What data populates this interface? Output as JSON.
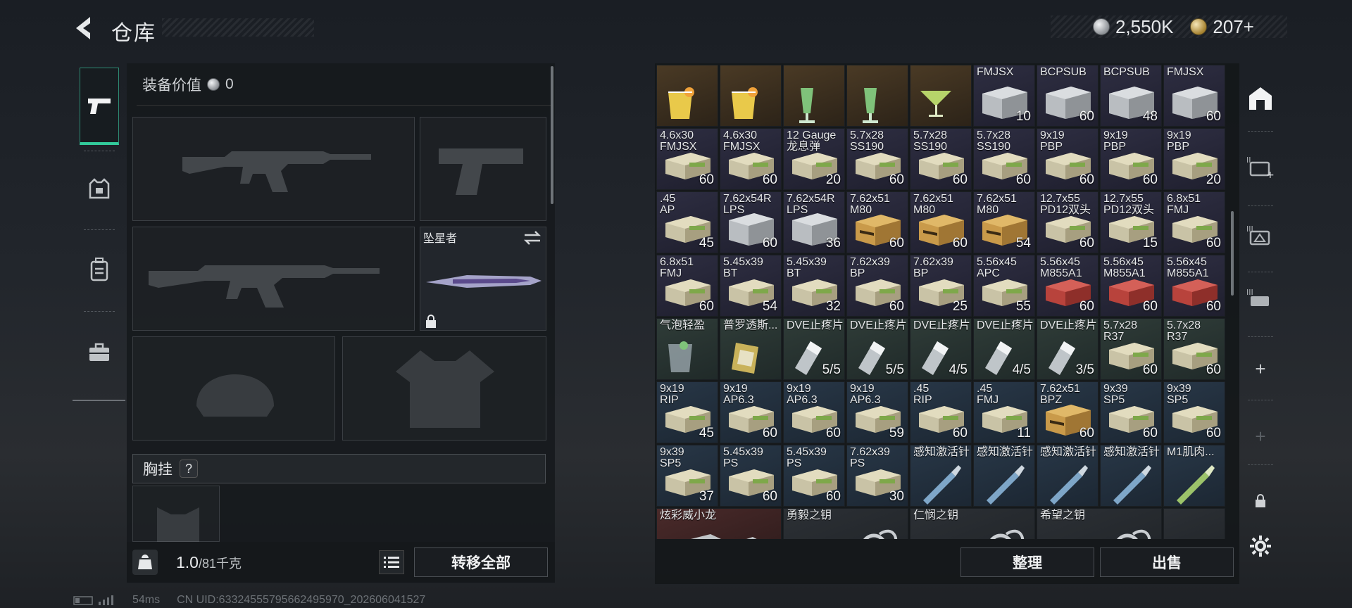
{
  "header": {
    "title": "仓库"
  },
  "currency": {
    "silver": "2,550K",
    "gold": "207+"
  },
  "equipment": {
    "value_label": "装备价值",
    "value": "0",
    "melee_name": "坠星者",
    "chest_label": "胸挂",
    "help": "?"
  },
  "footer": {
    "weight": "1.0",
    "weight_max": "/81千克",
    "move_all": "转移全部"
  },
  "status": {
    "ping": "54ms",
    "uid": "CN UID:6332455579566249597​0_202606041527"
  },
  "actions": {
    "sort": "整理",
    "sell": "出售"
  },
  "grid": {
    "rows": [
      [
        {
          "name": "",
          "count": "",
          "rarity": "gold",
          "art": "drink"
        },
        {
          "name": "",
          "count": "",
          "rarity": "gold",
          "art": "drink"
        },
        {
          "name": "",
          "count": "",
          "rarity": "gold",
          "art": "drink2"
        },
        {
          "name": "",
          "count": "",
          "rarity": "gold",
          "art": "drink2"
        },
        {
          "name": "",
          "count": "",
          "rarity": "gold",
          "art": "drink3"
        },
        {
          "name": "FMJSX",
          "count": "10",
          "rarity": "purple",
          "art": "box"
        },
        {
          "name": "BCPSUB",
          "count": "60",
          "rarity": "purple",
          "art": "box"
        },
        {
          "name": "BCPSUB",
          "count": "48",
          "rarity": "purple",
          "art": "box"
        },
        {
          "name": "FMJSX",
          "count": "60",
          "rarity": "purple",
          "art": "box"
        }
      ],
      [
        {
          "name": "4.6x30\nFMJSX",
          "count": "60",
          "rarity": "purple",
          "art": "ammo"
        },
        {
          "name": "4.6x30\nFMJSX",
          "count": "60",
          "rarity": "purple",
          "art": "ammo"
        },
        {
          "name": "12 Gauge\n龙息弹",
          "count": "20",
          "rarity": "purple",
          "art": "ammo"
        },
        {
          "name": "5.7x28\nSS190",
          "count": "60",
          "rarity": "purple",
          "art": "ammo"
        },
        {
          "name": "5.7x28\nSS190",
          "count": "60",
          "rarity": "purple",
          "art": "ammo"
        },
        {
          "name": "5.7x28\nSS190",
          "count": "60",
          "rarity": "purple",
          "art": "ammo"
        },
        {
          "name": "9x19\nPBP",
          "count": "60",
          "rarity": "purple",
          "art": "ammo"
        },
        {
          "name": "9x19\nPBP",
          "count": "60",
          "rarity": "purple",
          "art": "ammo"
        },
        {
          "name": "9x19\nPBP",
          "count": "20",
          "rarity": "purple",
          "art": "ammo"
        }
      ],
      [
        {
          "name": ".45\nAP",
          "count": "45",
          "rarity": "purple",
          "art": "ammo"
        },
        {
          "name": "7.62x54R\nLPS",
          "count": "60",
          "rarity": "purple",
          "art": "box"
        },
        {
          "name": "7.62x54R\nLPS",
          "count": "36",
          "rarity": "purple",
          "art": "box"
        },
        {
          "name": "7.62x51\nM80",
          "count": "60",
          "rarity": "purple",
          "art": "gold"
        },
        {
          "name": "7.62x51\nM80",
          "count": "60",
          "rarity": "purple",
          "art": "gold"
        },
        {
          "name": "7.62x51\nM80",
          "count": "54",
          "rarity": "purple",
          "art": "gold"
        },
        {
          "name": "12.7x55\nPD12双头",
          "count": "60",
          "rarity": "purple",
          "art": "ammo"
        },
        {
          "name": "12.7x55\nPD12双头",
          "count": "15",
          "rarity": "purple",
          "art": "ammo"
        },
        {
          "name": "6.8x51\nFMJ",
          "count": "60",
          "rarity": "purple",
          "art": "ammo"
        }
      ],
      [
        {
          "name": "6.8x51\nFMJ",
          "count": "60",
          "rarity": "purple",
          "art": "ammo"
        },
        {
          "name": "5.45x39\nBT",
          "count": "54",
          "rarity": "purple",
          "art": "ammo"
        },
        {
          "name": "5.45x39\nBT",
          "count": "32",
          "rarity": "purple",
          "art": "ammo"
        },
        {
          "name": "7.62x39\nBP",
          "count": "60",
          "rarity": "purple",
          "art": "ammo"
        },
        {
          "name": "7.62x39\nBP",
          "count": "25",
          "rarity": "purple",
          "art": "ammo"
        },
        {
          "name": "5.56x45\nAPC",
          "count": "55",
          "rarity": "purple",
          "art": "ammo"
        },
        {
          "name": "5.56x45\nM855A1",
          "count": "60",
          "rarity": "purple",
          "art": "red"
        },
        {
          "name": "5.56x45\nM855A1",
          "count": "60",
          "rarity": "purple",
          "art": "red"
        },
        {
          "name": "5.56x45\nM855A1",
          "count": "60",
          "rarity": "purple",
          "art": "red"
        }
      ],
      [
        {
          "name": "气泡轻盈",
          "count": "",
          "rarity": "green",
          "art": "glass"
        },
        {
          "name": "普罗透斯...",
          "count": "",
          "rarity": "green",
          "art": "pack"
        },
        {
          "name": "DVE止疼片",
          "count": "5/5",
          "rarity": "green",
          "art": "pill"
        },
        {
          "name": "DVE止疼片",
          "count": "5/5",
          "rarity": "green",
          "art": "pill"
        },
        {
          "name": "DVE止疼片",
          "count": "4/5",
          "rarity": "green",
          "art": "pill"
        },
        {
          "name": "DVE止疼片",
          "count": "4/5",
          "rarity": "green",
          "art": "pill"
        },
        {
          "name": "DVE止疼片",
          "count": "3/5",
          "rarity": "green",
          "art": "pill"
        },
        {
          "name": "5.7x28\nR37",
          "count": "60",
          "rarity": "green",
          "art": "ammo"
        },
        {
          "name": "5.7x28\nR37",
          "count": "60",
          "rarity": "green",
          "art": "ammo"
        }
      ],
      [
        {
          "name": "9x19\nRIP",
          "count": "45",
          "rarity": "blue",
          "art": "ammo"
        },
        {
          "name": "9x19\nAP6.3",
          "count": "60",
          "rarity": "blue",
          "art": "ammo"
        },
        {
          "name": "9x19\nAP6.3",
          "count": "60",
          "rarity": "blue",
          "art": "ammo"
        },
        {
          "name": "9x19\nAP6.3",
          "count": "59",
          "rarity": "blue",
          "art": "ammo"
        },
        {
          "name": ".45\nRIP",
          "count": "60",
          "rarity": "blue",
          "art": "ammo"
        },
        {
          "name": ".45\nFMJ",
          "count": "11",
          "rarity": "blue",
          "art": "ammo"
        },
        {
          "name": "7.62x51\nBPZ",
          "count": "60",
          "rarity": "blue",
          "art": "gold"
        },
        {
          "name": "9x39\nSP5",
          "count": "60",
          "rarity": "blue",
          "art": "ammo"
        },
        {
          "name": "9x39\nSP5",
          "count": "60",
          "rarity": "blue",
          "art": "ammo"
        }
      ],
      [
        {
          "name": "9x39\nSP5",
          "count": "37",
          "rarity": "blue",
          "art": "ammo"
        },
        {
          "name": "5.45x39\nPS",
          "count": "60",
          "rarity": "blue",
          "art": "ammo"
        },
        {
          "name": "5.45x39\nPS",
          "count": "60",
          "rarity": "blue",
          "art": "ammo"
        },
        {
          "name": "7.62x39\nPS",
          "count": "30",
          "rarity": "blue",
          "art": "ammo"
        },
        {
          "name": "感知激活针",
          "count": "",
          "rarity": "blue",
          "art": "syringe"
        },
        {
          "name": "感知激活针",
          "count": "",
          "rarity": "blue",
          "art": "syringe"
        },
        {
          "name": "感知激活针",
          "count": "",
          "rarity": "blue",
          "art": "syringe"
        },
        {
          "name": "感知激活针",
          "count": "",
          "rarity": "blue",
          "art": "syringe"
        },
        {
          "name": "M1肌肉...",
          "count": "",
          "rarity": "blue",
          "art": "syringe2"
        }
      ],
      [
        {
          "name": "炫彩威小龙",
          "count": "",
          "rarity": "red",
          "art": "dragon",
          "wide": true
        },
        {
          "name": "勇毅之钥",
          "count": "",
          "rarity": "gray",
          "art": "key",
          "wide": true
        },
        {
          "name": "仁悯之钥",
          "count": "",
          "rarity": "gray",
          "art": "key",
          "wide": true
        },
        {
          "name": "希望之钥",
          "count": "",
          "rarity": "gray",
          "art": "key",
          "wide": true
        },
        {
          "name": "",
          "count": "",
          "rarity": "gray",
          "art": "none"
        }
      ]
    ]
  }
}
